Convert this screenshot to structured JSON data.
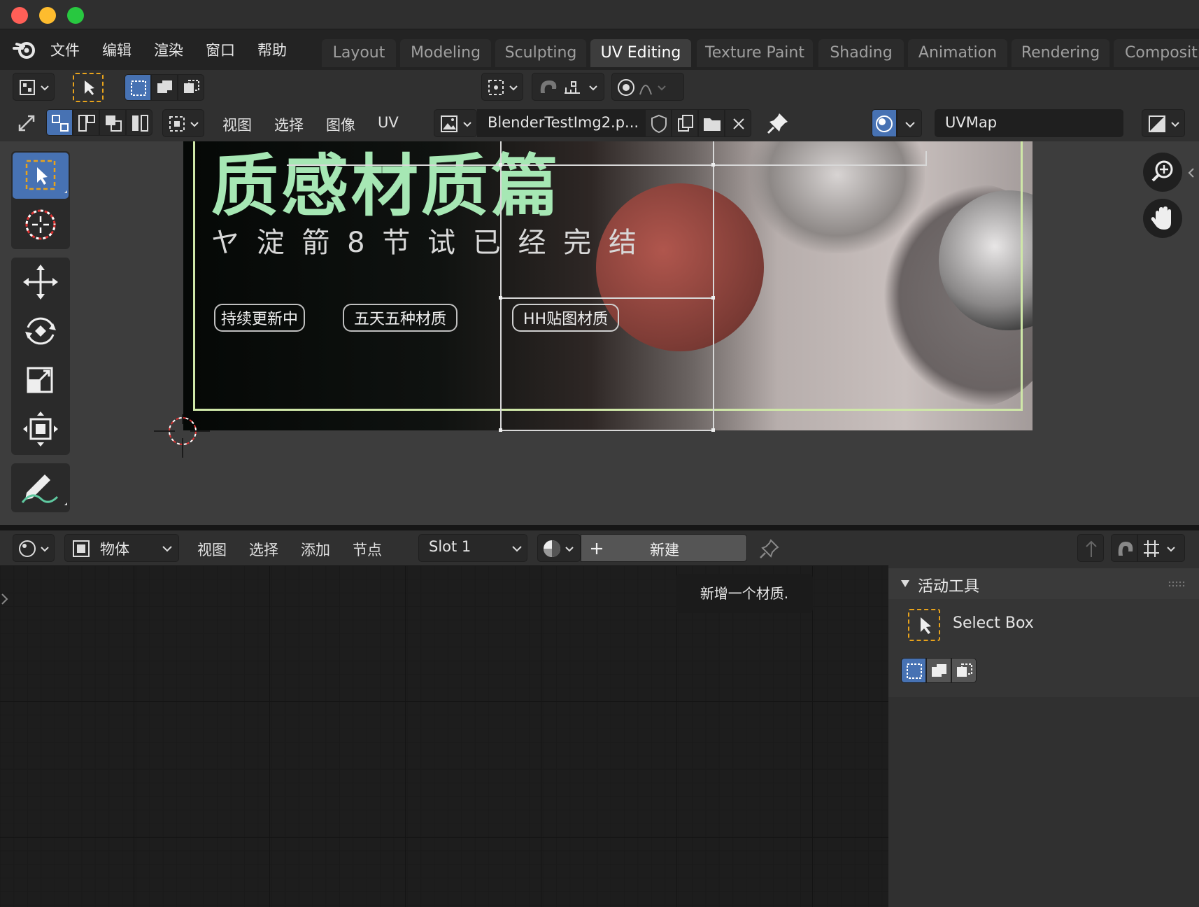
{
  "window": {
    "traffic_lights": [
      "#ff5f57",
      "#febc2e",
      "#28c840"
    ]
  },
  "menubar": {
    "logo": "blender-logo-icon",
    "items": [
      "文件",
      "编辑",
      "渲染",
      "窗口",
      "帮助"
    ]
  },
  "workspaces": {
    "tabs": [
      "Layout",
      "Modeling",
      "Sculpting",
      "UV Editing",
      "Texture Paint",
      "Shading",
      "Animation",
      "Rendering",
      "Compositi"
    ],
    "active": "UV Editing"
  },
  "uv_editor": {
    "menus": [
      "视图",
      "选择",
      "图像",
      "UV"
    ],
    "image_name": "BlenderTestImg2.p...",
    "uv_map": "UVMap",
    "image_text": {
      "title": "质感材质篇",
      "subtitle": "ヤ 淀 箭 8 节 试 已 经 完 结",
      "badges": [
        "持续更新中",
        "五天五种材质",
        "HH贴图材质"
      ]
    }
  },
  "node_editor": {
    "object_type": "物体",
    "menus": [
      "视图",
      "选择",
      "添加",
      "节点"
    ],
    "slot": "Slot 1",
    "new_button": "新建",
    "tooltip": "新增一个材质."
  },
  "side_panel": {
    "section_title": "活动工具",
    "tool_name": "Select Box"
  },
  "colors": {
    "accent_blue": "#4772b3",
    "select_orange": "#e8a31c"
  }
}
